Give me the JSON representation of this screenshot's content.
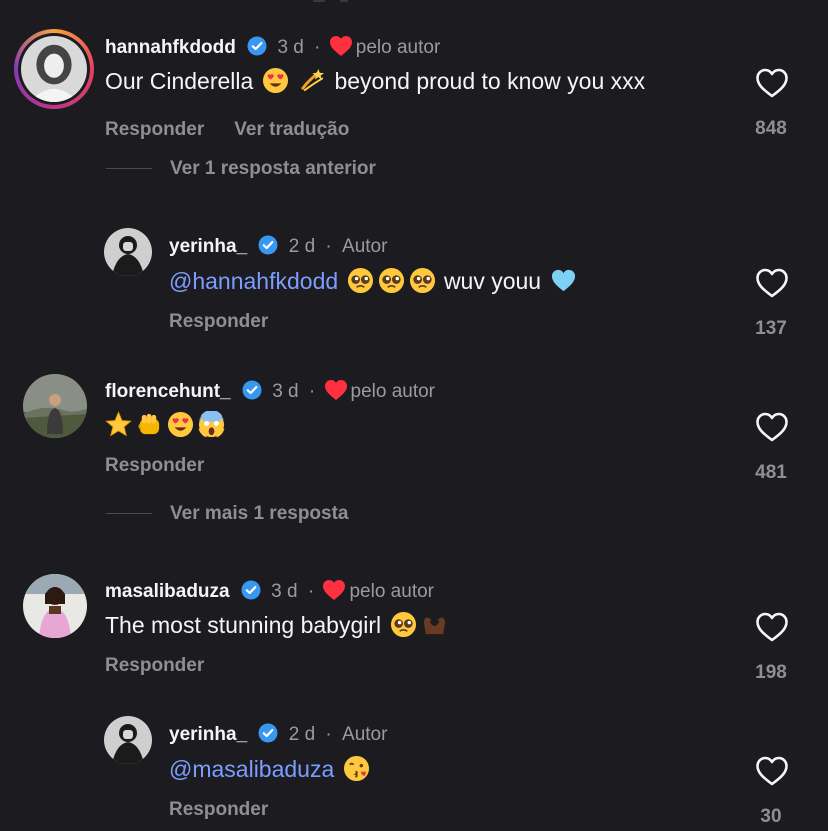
{
  "comments": [
    {
      "username": "hannahfkdodd",
      "time": "3 d",
      "separator": "·",
      "liked_by_author": "pelo autor",
      "text": "Our Cinderella",
      "text_emojis": [
        "heart-eyes-emoji",
        "dizzy-emoji"
      ],
      "text_after": "beyond proud to know you xxx",
      "actions": [
        "Responder",
        "Ver tradução"
      ],
      "likes": "848",
      "more_replies": "Ver 1 resposta anterior"
    },
    {
      "username": "yerinha_",
      "time": "2 d",
      "separator": "·",
      "role": "Autor",
      "mention": "@hannahfkdodd",
      "text_emojis": [
        "pleading-face-emoji",
        "pleading-face-emoji",
        "pleading-face-emoji"
      ],
      "text_after": "wuv youu",
      "trailing_emoji": "light-blue-heart-emoji",
      "actions": [
        "Responder"
      ],
      "likes": "137"
    },
    {
      "username": "florencehunt_",
      "time": "3 d",
      "separator": "·",
      "liked_by_author": "pelo autor",
      "text_emojis": [
        "star-emoji",
        "fist-emoji",
        "heart-eyes-emoji",
        "scream-emoji"
      ],
      "actions": [
        "Responder"
      ],
      "likes": "481",
      "more_replies": "Ver mais 1 resposta"
    },
    {
      "username": "masalibaduza",
      "time": "3 d",
      "separator": "·",
      "liked_by_author": "pelo autor",
      "text": "The most stunning babygirl",
      "text_emojis": [
        "pleading-face-emoji",
        "heart-hands-emoji"
      ],
      "actions": [
        "Responder"
      ],
      "likes": "198"
    },
    {
      "username": "yerinha_",
      "time": "2 d",
      "separator": "·",
      "role": "Autor",
      "mention": "@masalibaduza",
      "text_emojis": [
        "kissing-heart-emoji"
      ],
      "actions": [
        "Responder"
      ],
      "likes": "30"
    }
  ],
  "colors": {
    "background": "#1c1c20",
    "mention": "#7c9dff",
    "verified": "#3897f0",
    "liked_heart": "#ff3040",
    "secondary_text": "#8e8e94"
  },
  "icons": [
    "verified-badge-icon",
    "heart-filled-icon",
    "heart-outline-icon"
  ]
}
